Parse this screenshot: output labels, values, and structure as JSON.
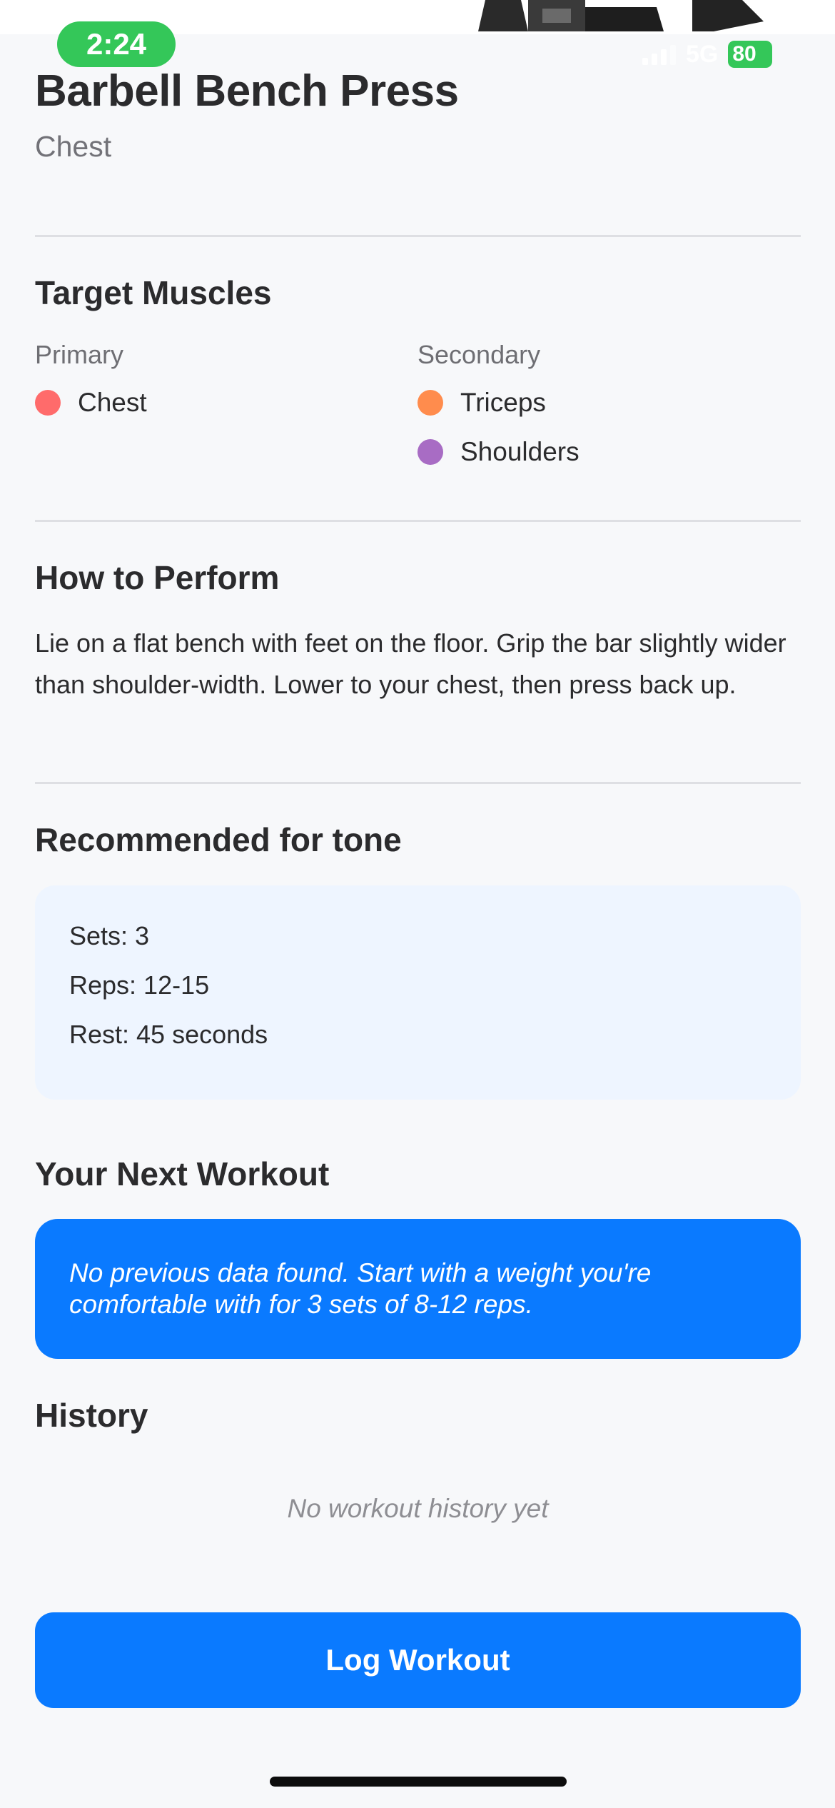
{
  "status_bar": {
    "time": "2:24",
    "network": "5G",
    "battery": "80"
  },
  "exercise": {
    "title": "Barbell Bench Press",
    "category": "Chest"
  },
  "target_muscles": {
    "heading": "Target Muscles",
    "primary_label": "Primary",
    "secondary_label": "Secondary",
    "primary": [
      {
        "name": "Chest",
        "color": "#ff6b6b"
      }
    ],
    "secondary": [
      {
        "name": "Triceps",
        "color": "#ff8c4d"
      },
      {
        "name": "Shoulders",
        "color": "#a86cc4"
      }
    ]
  },
  "how_to": {
    "heading": "How to Perform",
    "description": "Lie on a flat bench with feet on the floor. Grip the bar slightly wider than shoulder-width. Lower to your chest, then press back up."
  },
  "recommended": {
    "heading": "Recommended for tone",
    "sets": "Sets: 3",
    "reps": "Reps: 12-15",
    "rest": "Rest: 45 seconds"
  },
  "next_workout": {
    "heading": "Your Next Workout",
    "message": "No previous data found. Start with a weight you're comfortable with for 3 sets of 8-12 reps."
  },
  "history": {
    "heading": "History",
    "empty_message": "No workout history yet"
  },
  "actions": {
    "log_workout_label": "Log Workout"
  },
  "colors": {
    "accent": "#0a7aff",
    "status_green": "#34c759"
  }
}
